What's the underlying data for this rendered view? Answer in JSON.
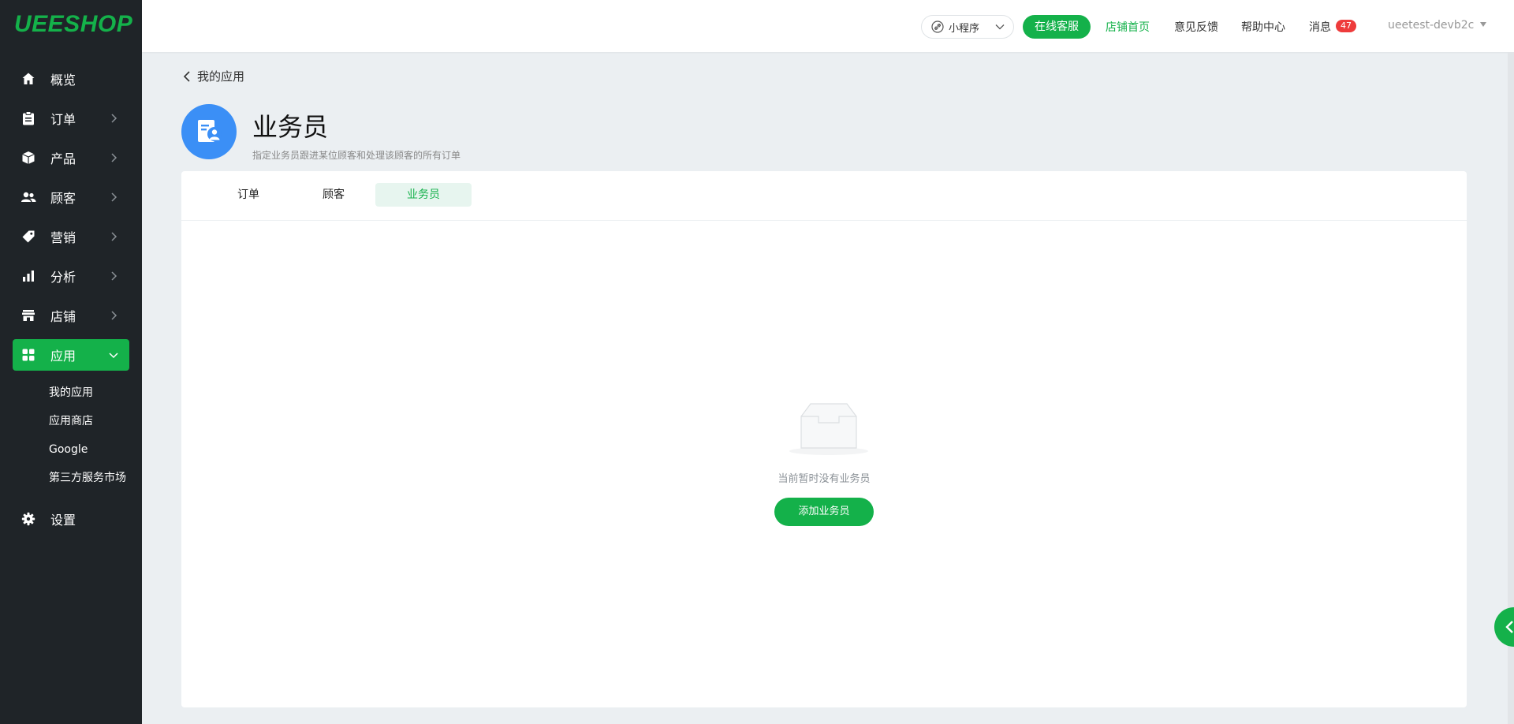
{
  "brand": {
    "logo_text": "UEESHOP"
  },
  "sidebar": {
    "items": [
      {
        "label": "概览",
        "icon": "home-icon"
      },
      {
        "label": "订单",
        "icon": "clipboard-icon"
      },
      {
        "label": "产品",
        "icon": "box-icon"
      },
      {
        "label": "顾客",
        "icon": "users-icon"
      },
      {
        "label": "营销",
        "icon": "tag-icon"
      },
      {
        "label": "分析",
        "icon": "bar-chart-icon"
      },
      {
        "label": "店铺",
        "icon": "store-icon"
      },
      {
        "label": "应用",
        "icon": "apps-icon"
      },
      {
        "label": "设置",
        "icon": "gear-icon"
      }
    ],
    "apps_submenu": [
      "我的应用",
      "应用商店",
      "Google",
      "第三方服务市场"
    ]
  },
  "topbar": {
    "mini_program": "小程序",
    "online_service": "在线客服",
    "store_home": "店铺首页",
    "feedback": "意见反馈",
    "help_center": "帮助中心",
    "messages": "消息",
    "message_count": "47",
    "username": "ueetest-devb2c"
  },
  "header": {
    "back_label": "我的应用",
    "title": "业务员",
    "description": "指定业务员跟进某位顾客和处理该顾客的所有订单"
  },
  "tabs": [
    "订单",
    "顾客",
    "业务员"
  ],
  "active_tab": "业务员",
  "empty_state": {
    "message": "当前暂时没有业务员",
    "button": "添加业务员"
  },
  "colors": {
    "accent": "#14b14a",
    "sidebar_bg": "#1f2428",
    "app_icon_bg": "#3b8ff6",
    "badge": "#ee3b3b"
  }
}
